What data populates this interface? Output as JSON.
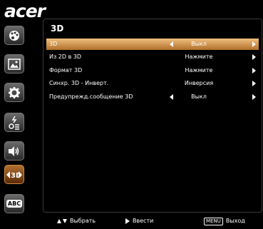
{
  "brand": "acer",
  "panel_title": "3D",
  "menu_rows": [
    {
      "label": "3D",
      "value": "Выкл",
      "selected": true,
      "left_arrow": true
    },
    {
      "label": "Из 2D в 3D",
      "value": "Нажмите",
      "selected": false,
      "left_arrow": false
    },
    {
      "label": "Формат 3D",
      "value": "Нажмите",
      "selected": false,
      "left_arrow": false
    },
    {
      "label": "Синхр. 3D - Инверт.",
      "value": "Инверсия",
      "selected": false,
      "left_arrow": false
    },
    {
      "label": "Предупрежд.сообщение 3D",
      "value": "Выкл",
      "selected": false,
      "left_arrow": true
    }
  ],
  "sidebar": [
    {
      "icon": "palette-icon"
    },
    {
      "icon": "image-icon"
    },
    {
      "icon": "gear-icon"
    },
    {
      "icon": "power-management-icon"
    },
    {
      "icon": "audio-icon"
    },
    {
      "icon": "3d-icon",
      "label": "3D",
      "active": true
    },
    {
      "icon": "language-icon",
      "label": "ABC"
    }
  ],
  "footer": {
    "select_label": "Выбрать",
    "enter_label": "Ввести",
    "menu_key": "MENU",
    "exit_label": "Выход"
  }
}
